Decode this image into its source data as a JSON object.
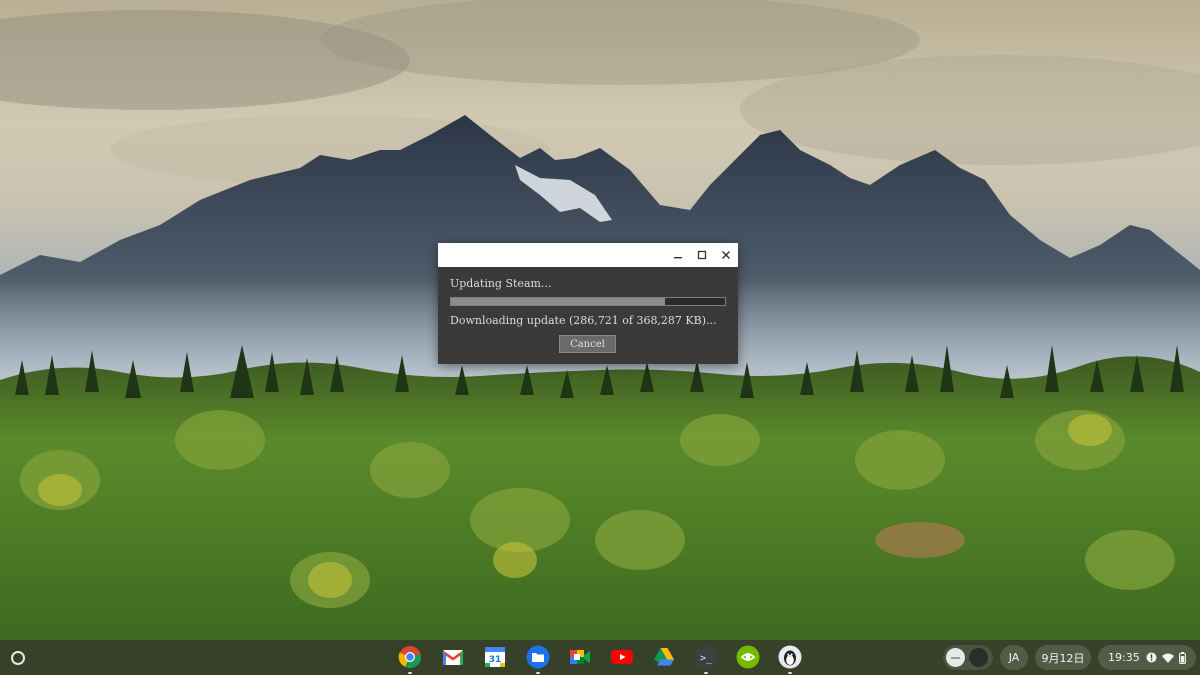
{
  "dialog": {
    "status": "Updating Steam...",
    "progress": 0.78,
    "detail": "Downloading update (286,721 of 368,287 KB)...",
    "cancel_label": "Cancel"
  },
  "shelf": {
    "apps": [
      {
        "name": "chrome-icon"
      },
      {
        "name": "gmail-icon"
      },
      {
        "name": "calendar-icon",
        "label": "31"
      },
      {
        "name": "files-icon"
      },
      {
        "name": "meet-icon"
      },
      {
        "name": "youtube-icon"
      },
      {
        "name": "drive-icon"
      },
      {
        "name": "terminal-icon",
        "label": ">_"
      },
      {
        "name": "nvidia-icon"
      },
      {
        "name": "penguin-icon"
      }
    ],
    "ime": "JA",
    "date": "9月12日",
    "time": "19:35"
  },
  "colors": {
    "dialog_bg": "#3b3a39",
    "shelf_bg": "#34342a"
  }
}
